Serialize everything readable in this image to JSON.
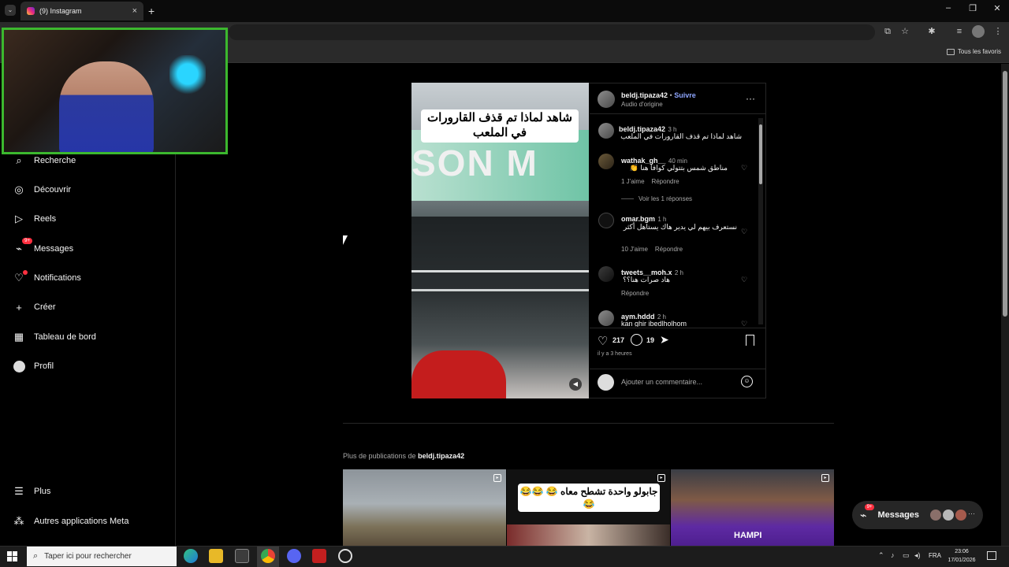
{
  "browser": {
    "tab_title": "(9) Instagram",
    "bookmarks_folder": "Tous les favoris"
  },
  "sidebar": {
    "items": [
      {
        "label": "Recherche",
        "icon": "search-icon"
      },
      {
        "label": "Découvrir",
        "icon": "compass-icon"
      },
      {
        "label": "Reels",
        "icon": "reels-icon"
      },
      {
        "label": "Messages",
        "icon": "messenger-icon",
        "badge": "9+"
      },
      {
        "label": "Notifications",
        "icon": "heart-icon"
      },
      {
        "label": "Créer",
        "icon": "plus-icon"
      },
      {
        "label": "Tableau de bord",
        "icon": "dashboard-icon"
      },
      {
        "label": "Profil",
        "icon": "profile-avatar"
      }
    ],
    "bottom_items": [
      {
        "label": "Plus",
        "icon": "menu-icon"
      },
      {
        "label": "Autres applications Meta",
        "icon": "meta-apps-icon"
      }
    ]
  },
  "post": {
    "media_caption": "شاهد لماذا تم قذف القارورات في الملعب",
    "media_sign_text": "SON M",
    "author": "beldj.tipaza42",
    "follow_label": "Suivre",
    "audio": "Audio d'origine",
    "caption_author": "beldj.tipaza42",
    "caption_time": "3 h",
    "caption_text": "شاهد لماذا تم قذف القارورات في الملعب",
    "comments": [
      {
        "user": "wathak_gh__",
        "time": "40 min",
        "text": "مناطق شمس بتتولي كوافا هنا 👏",
        "likes": "1 J'aime",
        "reply": "Répondre",
        "view_replies": "Voir les 1 réponses"
      },
      {
        "user": "omar.bgm",
        "time": "1 h",
        "text": "نستعرف بيهم لي يدير هاك يستاهل أكثر",
        "likes": "10 J'aime",
        "reply": "Répondre"
      },
      {
        "user": "tweets__moh.x",
        "time": "2 h",
        "text": "هاد صرات هنا؟؟",
        "reply": "Répondre"
      },
      {
        "user": "aym.hddd",
        "time": "2 h",
        "text": "kan ghir ibedlholhom"
      }
    ],
    "like_count": "217",
    "comment_count": "19",
    "posted_ago": "il y a 3 heures",
    "comment_placeholder": "Ajouter un commentaire..."
  },
  "more_section": {
    "prefix": "Plus de publications de",
    "author": "beldj.tipaza42",
    "thumbs": [
      {
        "caption": ""
      },
      {
        "caption": "جابولو واحدة تشطح معاه 😂 😂😂😂"
      },
      {
        "caption": "HAMPI"
      }
    ]
  },
  "messages_pill": {
    "label": "Messages",
    "badge": "9+"
  },
  "taskbar": {
    "search_placeholder": "Taper ici pour rechercher",
    "language": "FRA",
    "time": "23:06",
    "date": "17/01/2026"
  },
  "colors": {
    "link_blue": "#0095f6",
    "follow_blue": "#8ea6ff",
    "notification_red": "#ff3040",
    "webcam_border": "#3cb82e"
  }
}
